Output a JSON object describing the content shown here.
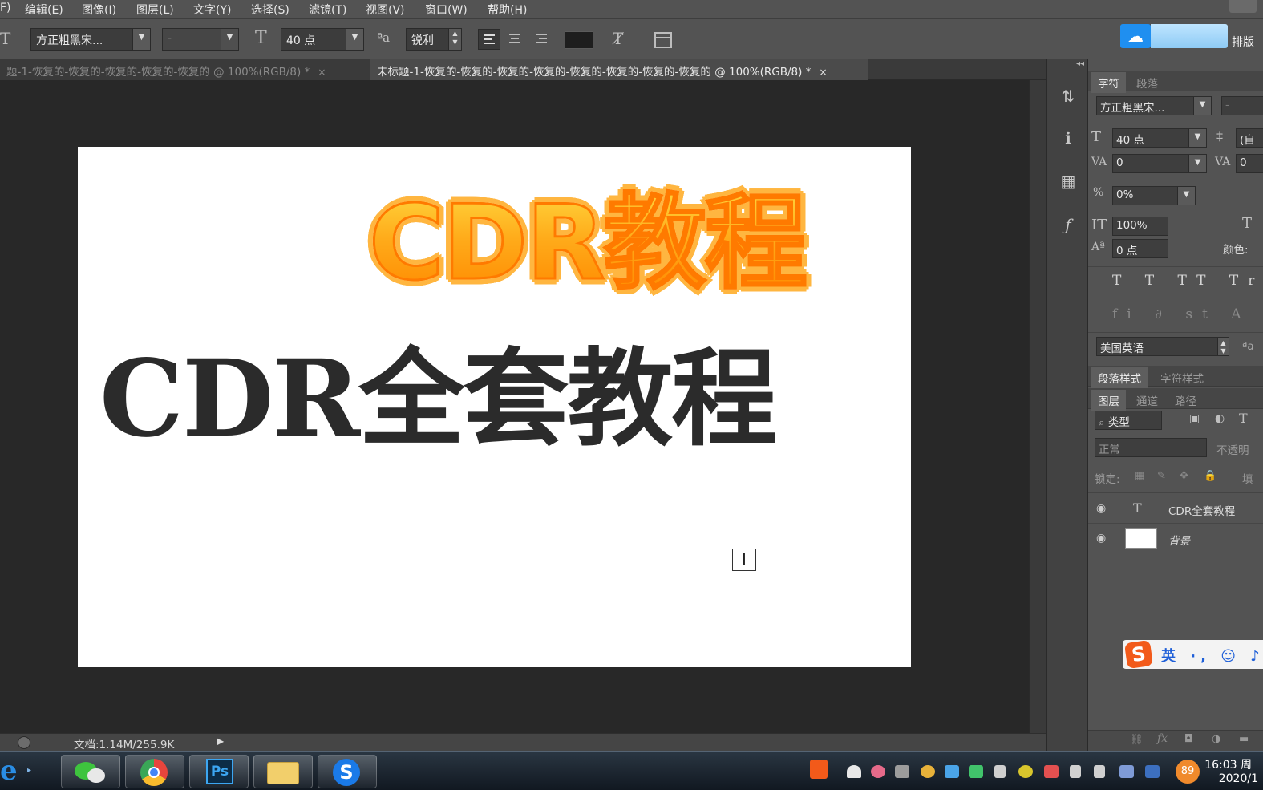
{
  "menu": [
    "F)",
    "编辑(E)",
    "图像(I)",
    "图层(L)",
    "文字(Y)",
    "选择(S)",
    "滤镜(T)",
    "视图(V)",
    "窗口(W)",
    "帮助(H)"
  ],
  "options": {
    "font_family": "方正粗黑宋...",
    "font_style": "-",
    "font_size": "40 点",
    "antialias_icon_label": "ªa",
    "antialias": "锐利",
    "right_label": "排版"
  },
  "tabs": {
    "inactive_title": "题-1-恢复的-恢复的-恢复的-恢复的-恢复的 @ 100%(RGB/8) *",
    "active_title": "未标题-1-恢复的-恢复的-恢复的-恢复的-恢复的-恢复的-恢复的-恢复的 @ 100%(RGB/8) *",
    "close": "×"
  },
  "canvas": {
    "title_orange": "CDR教程",
    "title_black": "CDR全套教程",
    "colors": {
      "orange_top": "#ffd23a",
      "orange_bottom": "#ff8a00",
      "stroke": "#ff7a00",
      "black": "#2b2b2b"
    }
  },
  "status": {
    "doc": "文档:1.14M/255.9K"
  },
  "panel": {
    "tabs_top": [
      "字符",
      "段落"
    ],
    "font_family": "方正粗黑宋...",
    "font_style": "-",
    "font_size": "40 点",
    "leading": "(自",
    "kerning": "0",
    "tracking": "0",
    "scale_percent": "0%",
    "vertical_scale": "100%",
    "baseline": "0 点",
    "color_label": "颜色:",
    "type_row1": "T T TT Tr T' T,",
    "type_row2": "fi ∂ st A aa T",
    "language": "美国英语",
    "aa_label": "ªa",
    "style_tabs": [
      "段落样式",
      "字符样式"
    ],
    "layer_tabs": [
      "图层",
      "通道",
      "路径"
    ],
    "filter_kind": "类型",
    "blend_mode": "正常",
    "opacity_label": "不透明",
    "lock_label": "锁定:",
    "fill_label": "填",
    "layers": [
      {
        "name": "CDR全套教程",
        "kind": "T"
      },
      {
        "name": "背景",
        "kind": "image"
      }
    ]
  },
  "ime": {
    "text": "英 ·, ☺ ♪ ⊞"
  },
  "taskbar": {
    "apps": [
      "wechat",
      "chrome",
      "photoshop",
      "explorer",
      "sogou"
    ],
    "ps_label": "Ps",
    "badge": "89",
    "time": "16:03 周",
    "date": "2020/1"
  }
}
